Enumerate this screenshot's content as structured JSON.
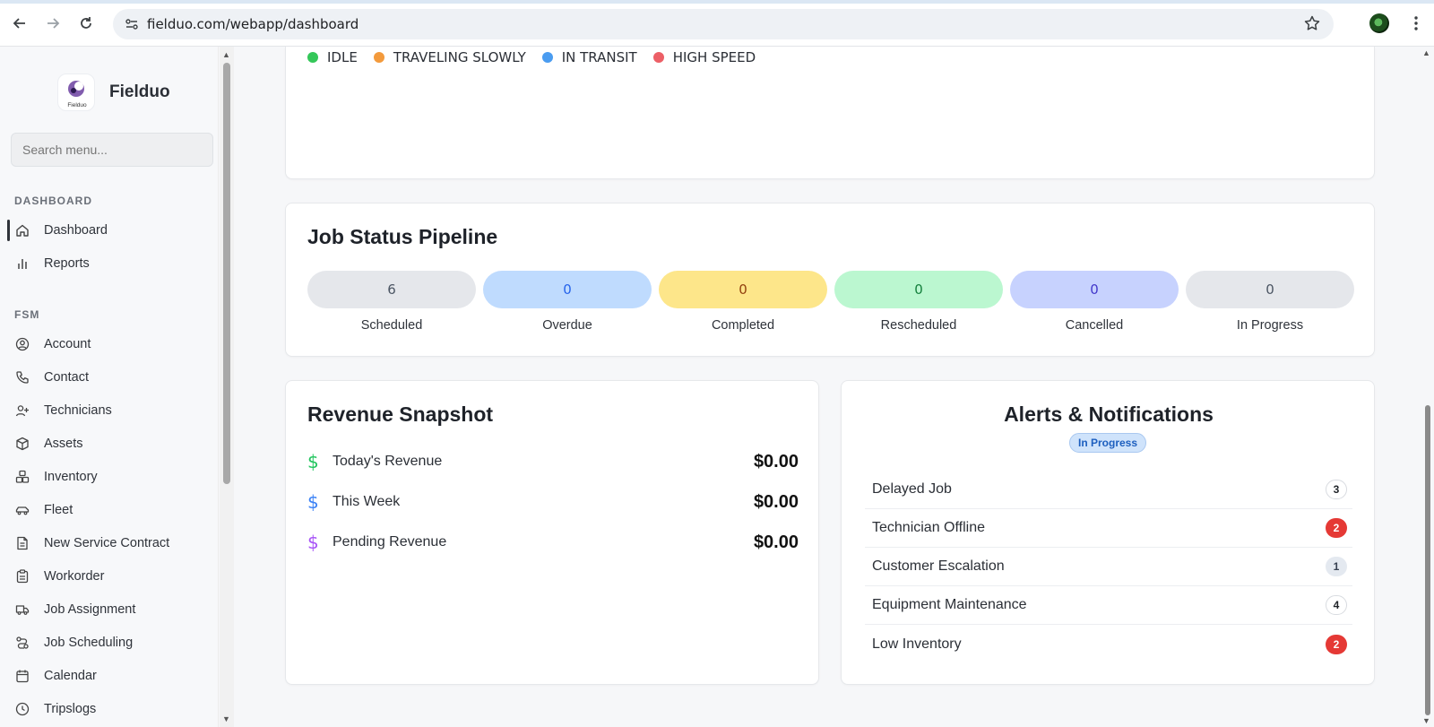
{
  "browser": {
    "url": "fielduo.com/webapp/dashboard"
  },
  "sidebar": {
    "brand": "Fielduo",
    "logo_text": "Fielduo",
    "search_placeholder": "Search menu...",
    "sections": [
      {
        "label": "DASHBOARD"
      },
      {
        "label": "FSM"
      }
    ],
    "items": [
      {
        "label": "Dashboard",
        "icon": "home-icon",
        "active": true
      },
      {
        "label": "Reports",
        "icon": "bar-chart-icon"
      },
      {
        "label": "Account",
        "icon": "user-circle-icon"
      },
      {
        "label": "Contact",
        "icon": "phone-icon"
      },
      {
        "label": "Technicians",
        "icon": "user-plus-icon"
      },
      {
        "label": "Assets",
        "icon": "box-icon"
      },
      {
        "label": "Inventory",
        "icon": "boxes-icon"
      },
      {
        "label": "Fleet",
        "icon": "car-icon"
      },
      {
        "label": "New Service Contract",
        "icon": "document-icon"
      },
      {
        "label": "Workorder",
        "icon": "clipboard-icon"
      },
      {
        "label": "Job Assignment",
        "icon": "truck-icon"
      },
      {
        "label": "Job Scheduling",
        "icon": "route-icon"
      },
      {
        "label": "Calendar",
        "icon": "calendar-icon"
      },
      {
        "label": "Tripslogs",
        "icon": "clock-icon"
      }
    ]
  },
  "map_legend": [
    {
      "label": "IDLE",
      "color": "#34c759"
    },
    {
      "label": "TRAVELING SLOWLY",
      "color": "#f39a3c"
    },
    {
      "label": "IN TRANSIT",
      "color": "#4a9cf0"
    },
    {
      "label": "HIGH SPEED",
      "color": "#ec5f66"
    }
  ],
  "pipeline": {
    "title": "Job Status Pipeline",
    "stages": [
      {
        "label": "Scheduled",
        "count": "6",
        "bg": "#e5e7eb",
        "fg": "#4b5563"
      },
      {
        "label": "Overdue",
        "count": "0",
        "bg": "#bfdbfe",
        "fg": "#2563eb"
      },
      {
        "label": "Completed",
        "count": "0",
        "bg": "#fde68a",
        "fg": "#92400e"
      },
      {
        "label": "Rescheduled",
        "count": "0",
        "bg": "#bbf7d0",
        "fg": "#15803d"
      },
      {
        "label": "Cancelled",
        "count": "0",
        "bg": "#c7d2fe",
        "fg": "#4338ca"
      },
      {
        "label": "In Progress",
        "count": "0",
        "bg": "#e5e7eb",
        "fg": "#4b5563"
      }
    ]
  },
  "revenue": {
    "title": "Revenue Snapshot",
    "rows": [
      {
        "label": "Today's Revenue",
        "value": "$0.00",
        "icon_color": "#22c55e"
      },
      {
        "label": "This Week",
        "value": "$0.00",
        "icon_color": "#3b82f6"
      },
      {
        "label": "Pending Revenue",
        "value": "$0.00",
        "icon_color": "#a855f7"
      }
    ],
    "currency_symbol": "$"
  },
  "alerts": {
    "title": "Alerts & Notifications",
    "badge": "In Progress",
    "rows": [
      {
        "label": "Delayed Job",
        "count": "3",
        "style": "outline"
      },
      {
        "label": "Technician Offline",
        "count": "2",
        "style": "danger"
      },
      {
        "label": "Customer Escalation",
        "count": "1",
        "style": "muted"
      },
      {
        "label": "Equipment Maintenance",
        "count": "4",
        "style": "outline"
      },
      {
        "label": "Low Inventory",
        "count": "2",
        "style": "danger"
      }
    ]
  }
}
